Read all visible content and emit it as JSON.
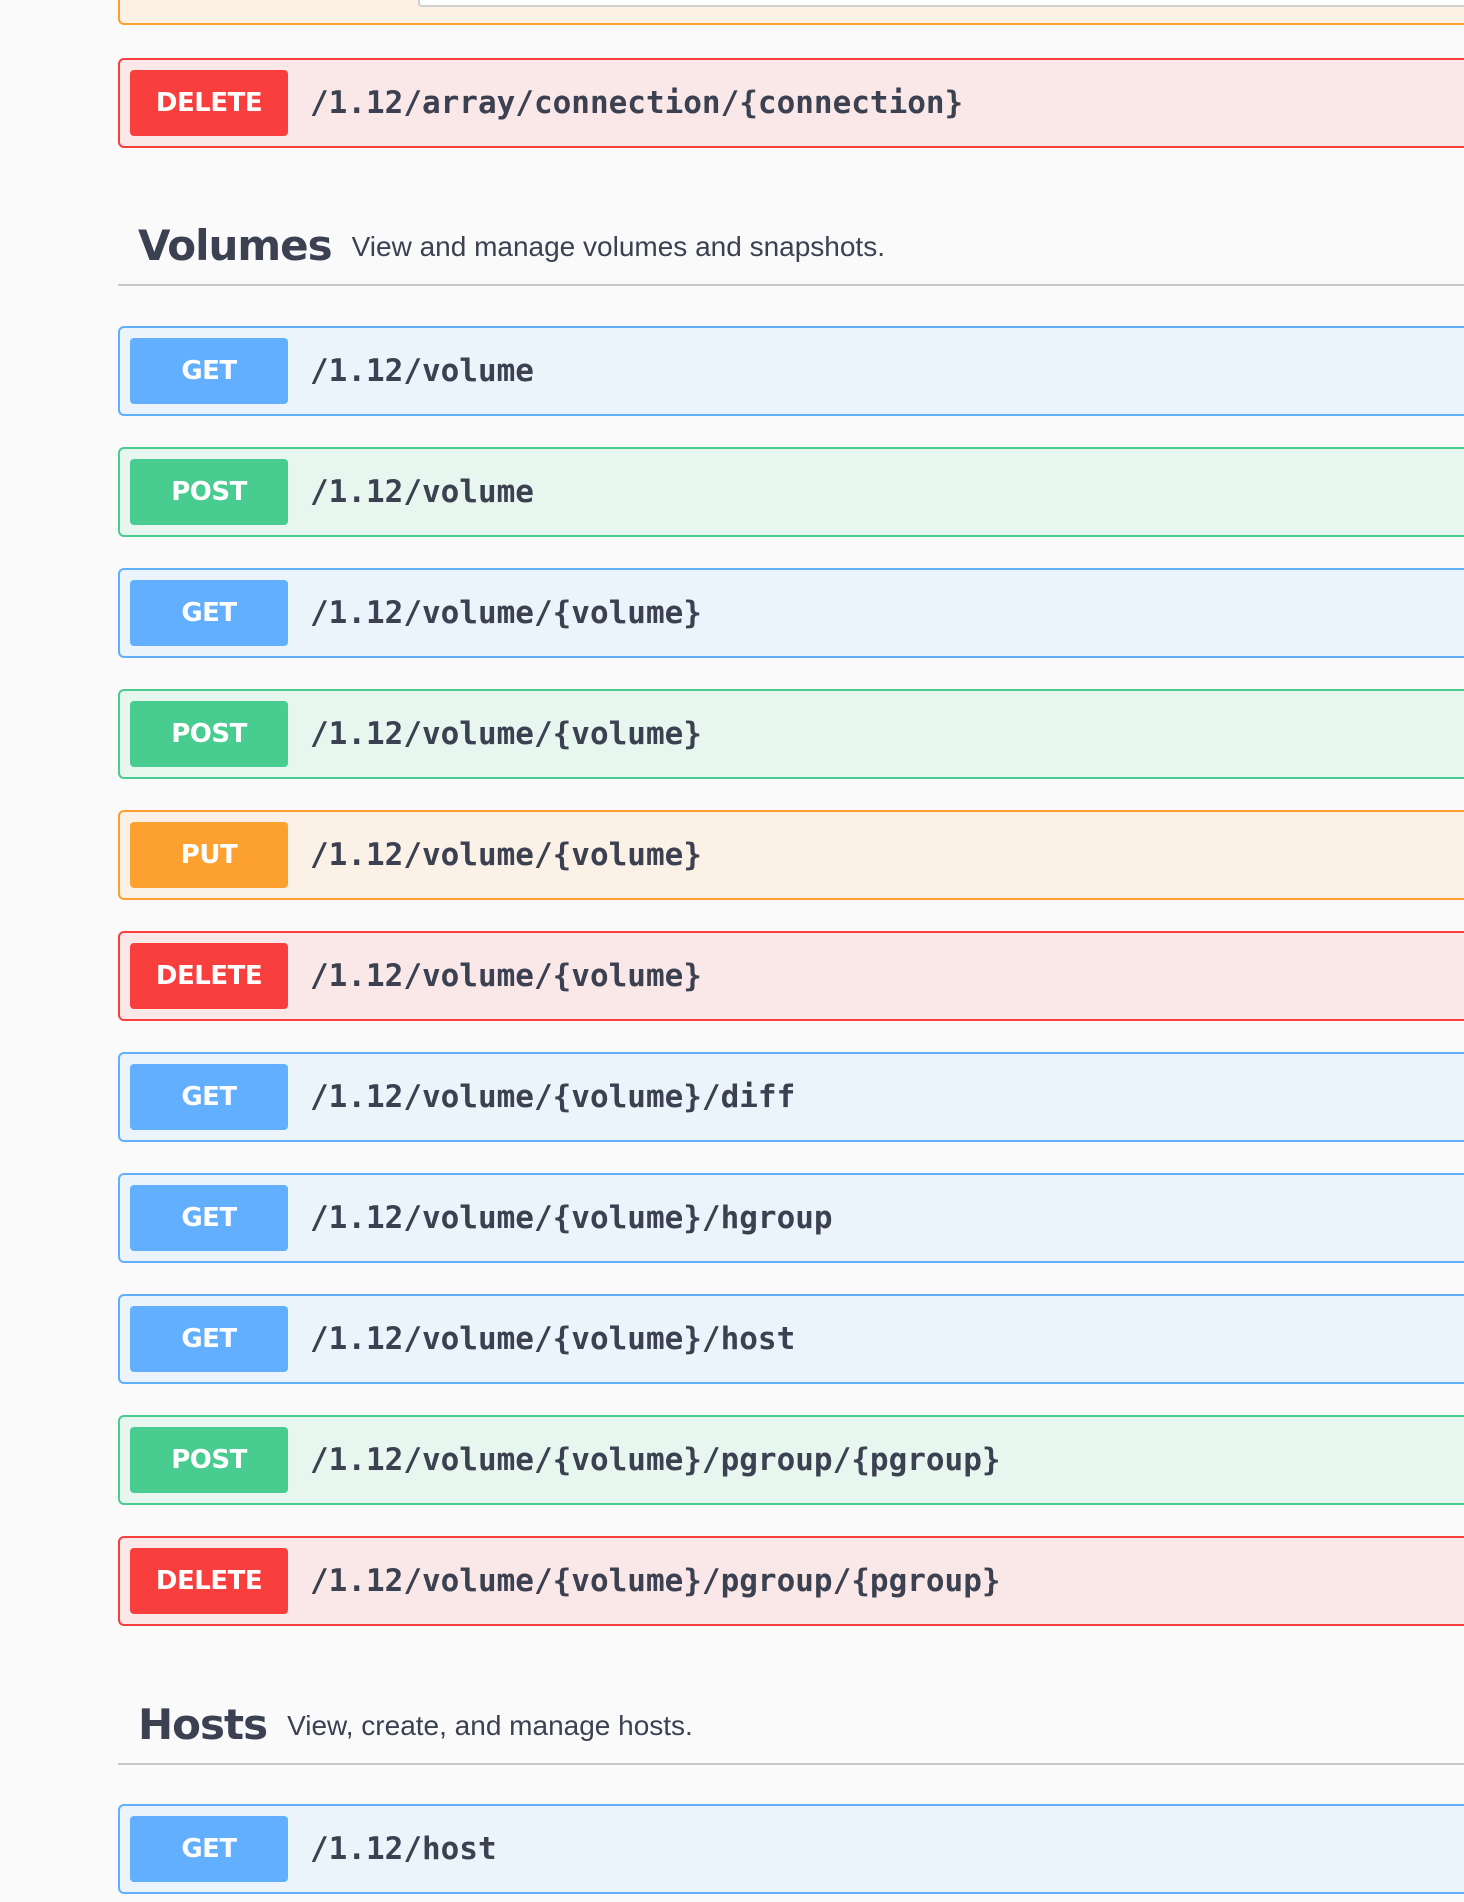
{
  "operations_top": [
    {
      "method": "DELETE",
      "path": "/1.12/array/connection/{connection}"
    }
  ],
  "tags": [
    {
      "name": "Volumes",
      "description": "View and manage volumes and snapshots."
    },
    {
      "name": "Hosts",
      "description": "View, create, and manage hosts."
    }
  ],
  "volumes_ops": [
    {
      "method": "GET",
      "path": "/1.12/volume"
    },
    {
      "method": "POST",
      "path": "/1.12/volume"
    },
    {
      "method": "GET",
      "path": "/1.12/volume/{volume}"
    },
    {
      "method": "POST",
      "path": "/1.12/volume/{volume}"
    },
    {
      "method": "PUT",
      "path": "/1.12/volume/{volume}"
    },
    {
      "method": "DELETE",
      "path": "/1.12/volume/{volume}"
    },
    {
      "method": "GET",
      "path": "/1.12/volume/{volume}/diff"
    },
    {
      "method": "GET",
      "path": "/1.12/volume/{volume}/hgroup"
    },
    {
      "method": "GET",
      "path": "/1.12/volume/{volume}/host"
    },
    {
      "method": "POST",
      "path": "/1.12/volume/{volume}/pgroup/{pgroup}"
    },
    {
      "method": "DELETE",
      "path": "/1.12/volume/{volume}/pgroup/{pgroup}"
    }
  ],
  "hosts_ops": [
    {
      "method": "GET",
      "path": "/1.12/host"
    }
  ],
  "colors": {
    "get": "#61affe",
    "post": "#49cc90",
    "put": "#fca130",
    "delete": "#f93e3e"
  }
}
